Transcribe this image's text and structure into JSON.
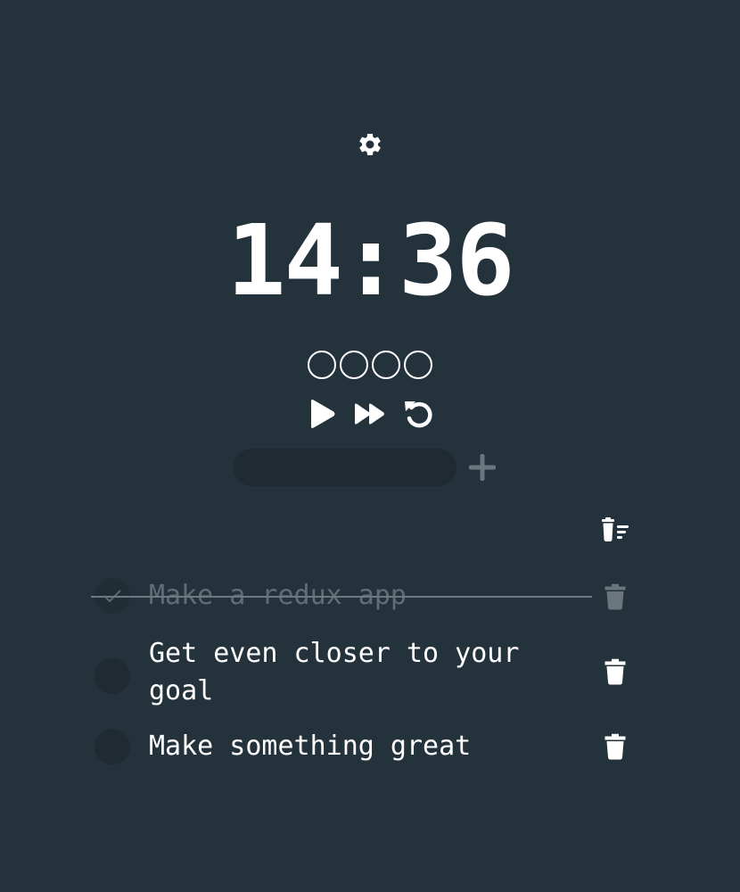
{
  "timer": {
    "display": "14:36",
    "rounds_total": 4,
    "rounds_completed": 0
  },
  "icons": {
    "settings": "gear-icon",
    "play": "play-icon",
    "skip": "fast-forward-icon",
    "reset": "reset-icon",
    "add": "plus-icon",
    "clear_all": "trash-list-icon",
    "delete": "trash-icon",
    "check": "checkmark-icon"
  },
  "new_task": {
    "value": "",
    "placeholder": ""
  },
  "tasks": [
    {
      "text": "Make a redux app",
      "done": true
    },
    {
      "text": "Get even closer to your goal",
      "done": false
    },
    {
      "text": "Make something great",
      "done": false
    }
  ],
  "colors": {
    "background": "#24323c",
    "input_background": "#1f2a31",
    "text": "#ffffff",
    "muted": "#5f6d75"
  }
}
